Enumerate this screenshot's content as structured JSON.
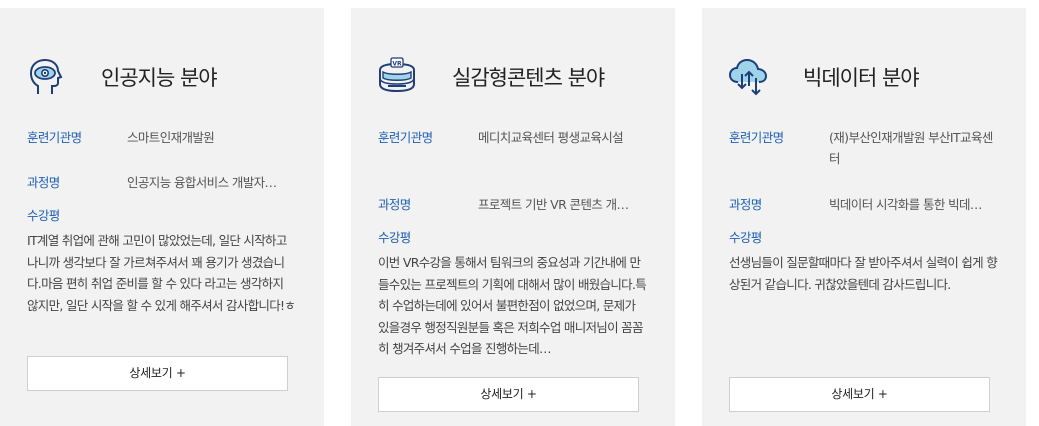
{
  "cards": [
    {
      "icon": "ai-head-eye-icon",
      "title": "인공지능 분야",
      "institution_label": "훈련기관명",
      "institution": "스마트인재개발원",
      "course_label": "과정명",
      "course": "인공지능 융합서비스 개발자…",
      "review_label": "수강평",
      "review": "IT계열 취업에 관해 고민이 많았었는데, 일단 시작하고 나니까 생각보다 잘 가르쳐주셔서 꽤 용기가 생겼습니다.마음 편히 취업 준비를 할 수 있다 라고는 생각하지 않지만, 일단 시작을 할 수 있게 해주셔서 감사합니다!ㅎ",
      "button": "상세보기 +"
    },
    {
      "icon": "vr-headset-icon",
      "title": "실감형콘텐츠 분야",
      "institution_label": "훈련기관명",
      "institution": "메디치교육센터 평생교육시설",
      "course_label": "과정명",
      "course": "프로젝트 기반 VR 콘텐츠 개…",
      "review_label": "수강평",
      "review": "이번 VR수강을 통해서 팀워크의 중요성과 기간내에 만들수있는 프로젝트의 기획에 대해서 많이 배웠습니다.특히 수업하는데에 있어서 불편한점이 없었으며, 문제가 있을경우 행정직원분들 혹은 저희수업 매니저님이 꼼꼼히 챙겨주셔서 수업을 진행하는데…",
      "button": "상세보기 +"
    },
    {
      "icon": "cloud-data-icon",
      "title": "빅데이터 분야",
      "institution_label": "훈련기관명",
      "institution": "(재)부산인재개발원 부산IT교육센터",
      "course_label": "과정명",
      "course": "빅데이터 시각화를 통한 빅데…",
      "review_label": "수강평",
      "review": "선생님들이 질문할때마다 잘 받아주셔서 실력이 쉽게 향상된거 같습니다. 귀찮았을텐데 감사드립니다.",
      "button": "상세보기 +"
    }
  ],
  "colors": {
    "accent": "#1f5fb5",
    "card_bg": "#f2f2f2",
    "icon_stroke": "#1e3f78",
    "icon_fill": "#9fd3ea"
  }
}
